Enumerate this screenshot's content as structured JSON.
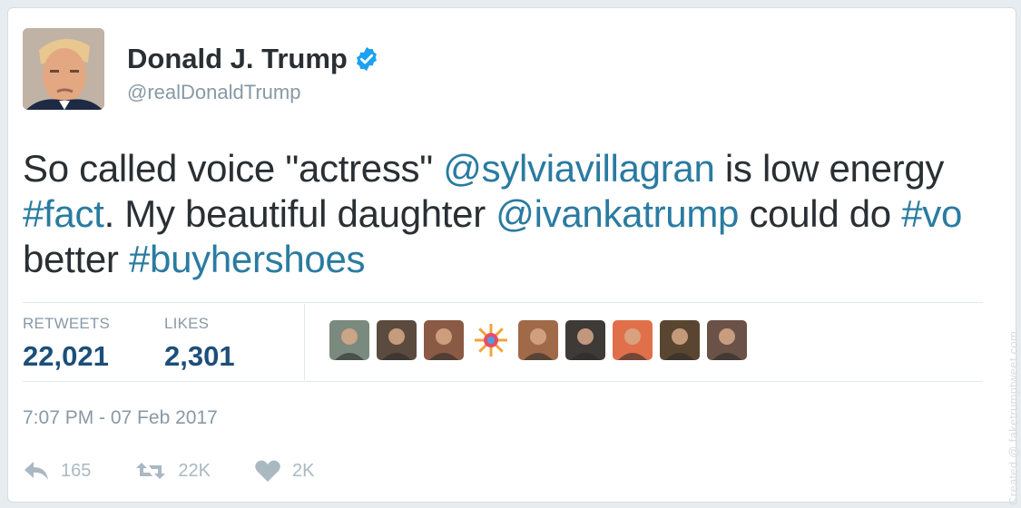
{
  "user": {
    "name": "Donald J. Trump",
    "handle": "@realDonaldTrump",
    "verified": true,
    "avatar_icon": "profile-photo"
  },
  "tweet": {
    "segments": [
      {
        "text": "So called voice \"actress\" ",
        "link": false
      },
      {
        "text": "@sylviavillagran",
        "link": true
      },
      {
        "text": " is low energy ",
        "link": false
      },
      {
        "text": "#fact",
        "link": true
      },
      {
        "text": ". My beautiful daughter ",
        "link": false
      },
      {
        "text": "@ivankatrump",
        "link": true
      },
      {
        "text": " could do ",
        "link": false
      },
      {
        "text": "#vo",
        "link": true
      },
      {
        "text": " better ",
        "link": false
      },
      {
        "text": "#buyhershoes",
        "link": true
      }
    ]
  },
  "stats": {
    "retweets_label": "RETWEETS",
    "retweets_value": "22,021",
    "likes_label": "LIKES",
    "likes_value": "2,301"
  },
  "likers": [
    {
      "icon": "liker-avatar",
      "color": "#7a8a7e"
    },
    {
      "icon": "liker-avatar",
      "color": "#5b4a3e"
    },
    {
      "icon": "liker-avatar",
      "color": "#8a5a44"
    },
    {
      "icon": "sun-avatar",
      "color": "#f2a43a"
    },
    {
      "icon": "liker-avatar",
      "color": "#a06a48"
    },
    {
      "icon": "liker-avatar",
      "color": "#3e3a38"
    },
    {
      "icon": "liker-avatar",
      "color": "#e0704a"
    },
    {
      "icon": "liker-avatar",
      "color": "#5a4630"
    },
    {
      "icon": "liker-avatar",
      "color": "#6a5248"
    }
  ],
  "timestamp": "7:07 PM - 07 Feb 2017",
  "actions": {
    "reply_count": "165",
    "retweet_count": "22K",
    "like_count": "2K"
  },
  "watermark": "Created @ faketrumptweet.com",
  "colors": {
    "link": "#2a7ba0",
    "verified": "#1da1f2",
    "muted": "#8899a6",
    "stat_value": "#1c4f7a"
  }
}
